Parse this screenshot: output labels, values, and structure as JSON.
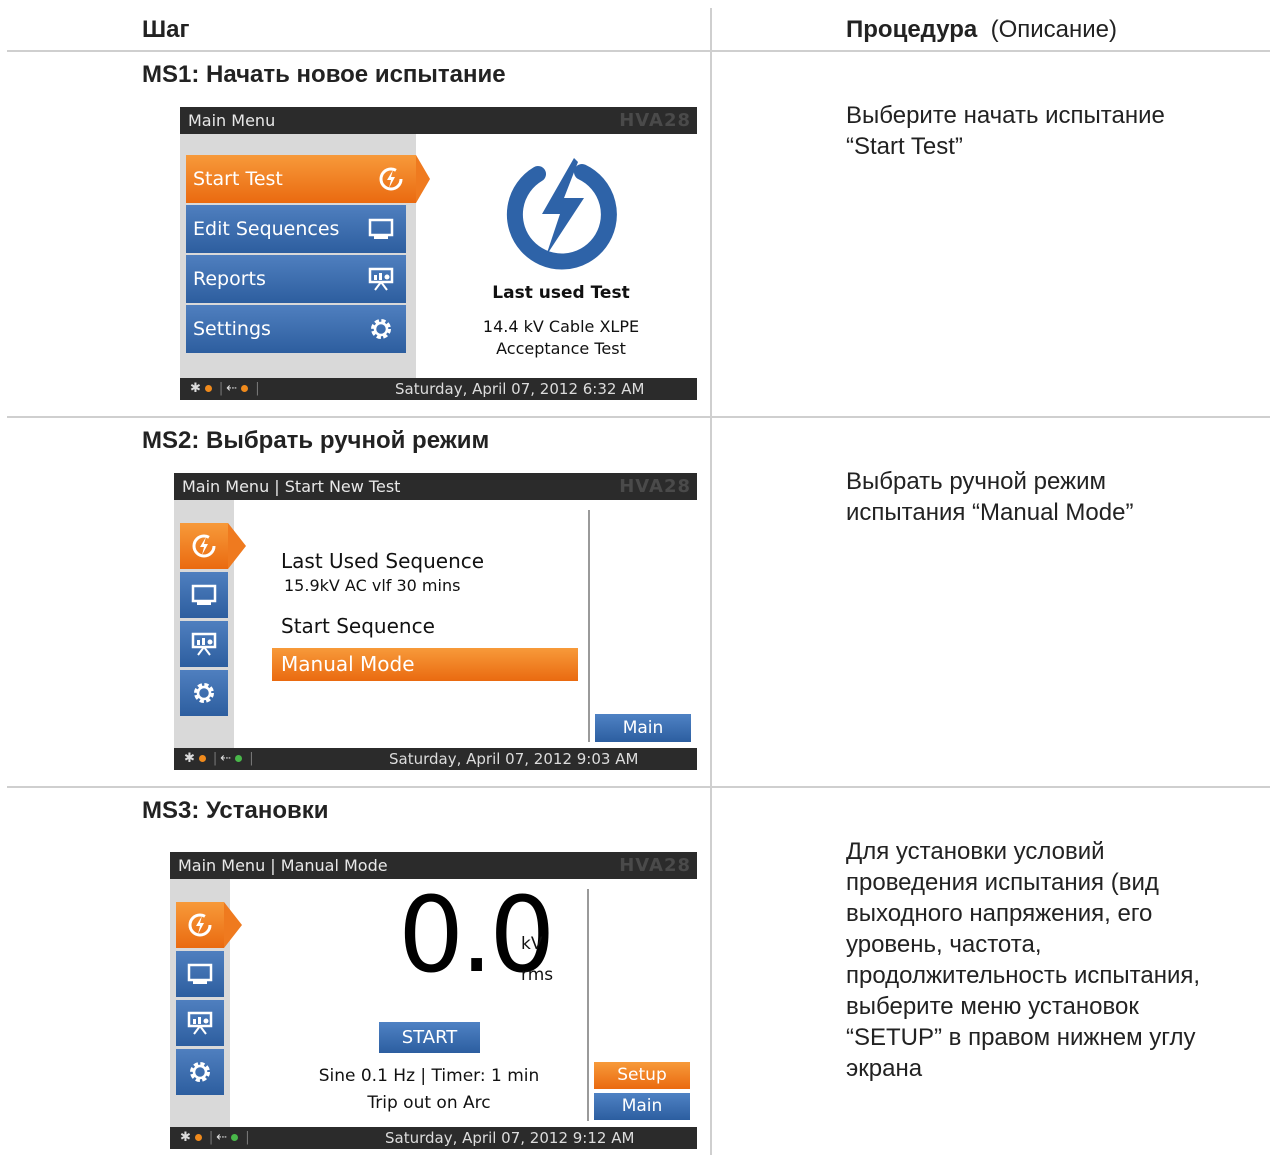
{
  "header": {
    "step_label": "Шаг",
    "procedure_label": "Процедура",
    "procedure_note": "(Описание)"
  },
  "rows": [
    {
      "title": "MS1: Начать новое испытание",
      "description": "Выберите начать испытание\n“Start Test”",
      "screen": {
        "topbar_title": "Main Menu",
        "brand": "HVA28",
        "menu": [
          {
            "label": "Start Test",
            "icon": "lightning-icon"
          },
          {
            "label": "Edit Sequences",
            "icon": "monitor-icon"
          },
          {
            "label": "Reports",
            "icon": "report-icon"
          },
          {
            "label": "Settings",
            "icon": "gear-icon"
          }
        ],
        "last_used_label": "Last used Test",
        "last_used_line1": "14.4 kV Cable XLPE",
        "last_used_line2": "Acceptance Test",
        "datetime": "Saturday, April 07, 2012 6:32 AM"
      }
    },
    {
      "title": "MS2: Выбрать ручной режим",
      "description": "Выбрать ручной режим\nиспытания  “Manual Mode”",
      "screen": {
        "topbar_title": "Main Menu  |  Start New Test",
        "brand": "HVA28",
        "last_used_seq": "Last Used Sequence",
        "last_used_seq_detail": "15.9kV AC vlf 30 mins",
        "start_sequence": "Start Sequence",
        "manual_mode": "Manual Mode",
        "main_button": "Main",
        "datetime": "Saturday, April 07, 2012 9:03 AM"
      }
    },
    {
      "title": "MS3: Установки",
      "description": "Для установки условий\nпроведения испытания (вид\nвыходного напряжения, его\nуровень, частота,\nпродолжительность испытания,\nвыберите меню установок\n“SETUP” в правом нижнем углу\nэкрана",
      "screen": {
        "topbar_title": "Main Menu  |  Manual Mode",
        "brand": "HVA28",
        "reading": "0.0",
        "unit_top": "kV",
        "unit_bottom": "rms",
        "start_button": "START",
        "info_line1": "Sine 0.1 Hz | Timer:  1 min",
        "info_line2": "Trip out on Arc",
        "setup_button": "Setup",
        "main_button": "Main",
        "datetime": "Saturday, April 07, 2012 9:12 AM"
      }
    }
  ],
  "colors": {
    "accent_orange": "#ef7a1f",
    "accent_blue": "#2d5e9f",
    "bar_dark": "#2b2b2b"
  }
}
